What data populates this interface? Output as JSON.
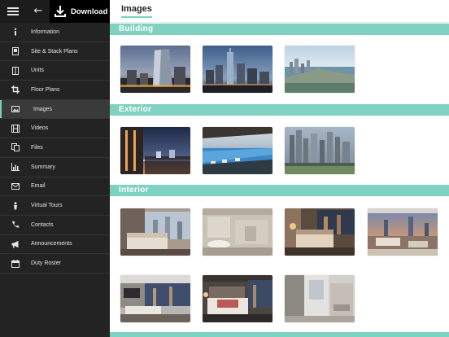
{
  "toolbar": {
    "menu_icon": "hamburger-icon",
    "back_icon": "arrow-left-icon",
    "download_label": "Download",
    "download_icon": "download-icon"
  },
  "sidebar": {
    "items": [
      {
        "label": "Information",
        "icon": "info-icon"
      },
      {
        "label": "Site & Stack Plans",
        "icon": "site-plan-icon"
      },
      {
        "label": "Units",
        "icon": "units-icon"
      },
      {
        "label": "Floor Plans",
        "icon": "crop-icon"
      },
      {
        "label": "Images",
        "icon": "image-icon",
        "active": true
      },
      {
        "label": "Videos",
        "icon": "film-icon"
      },
      {
        "label": "Files",
        "icon": "files-icon"
      },
      {
        "label": "Summary",
        "icon": "bar-chart-icon"
      },
      {
        "label": "Email",
        "icon": "envelope-icon"
      },
      {
        "label": "Virtual Tours",
        "icon": "person-icon"
      },
      {
        "label": "Contacts",
        "icon": "phone-icon"
      },
      {
        "label": "Announcements",
        "icon": "megaphone-icon"
      },
      {
        "label": "Duty Roster",
        "icon": "calendar-icon"
      }
    ]
  },
  "page": {
    "title": "Images"
  },
  "sections": [
    {
      "label": "Building",
      "thumbs": [
        "building-tower-dusk",
        "building-skyline-dusk",
        "building-bay-aerial"
      ]
    },
    {
      "label": "Exterior",
      "thumbs": [
        "exterior-balcony-night",
        "exterior-infinity-pool",
        "exterior-sky-garden"
      ]
    },
    {
      "label": "Interior",
      "thumbs": [
        "interior-bedroom-window",
        "interior-bathroom",
        "interior-bedroom-warm",
        "interior-living-view",
        "interior-living-night",
        "interior-master-bedroom",
        "interior-shower"
      ]
    }
  ],
  "colors": {
    "accent": "#7fd2c1",
    "sidebar": "#232323",
    "download_bg": "#000000"
  }
}
